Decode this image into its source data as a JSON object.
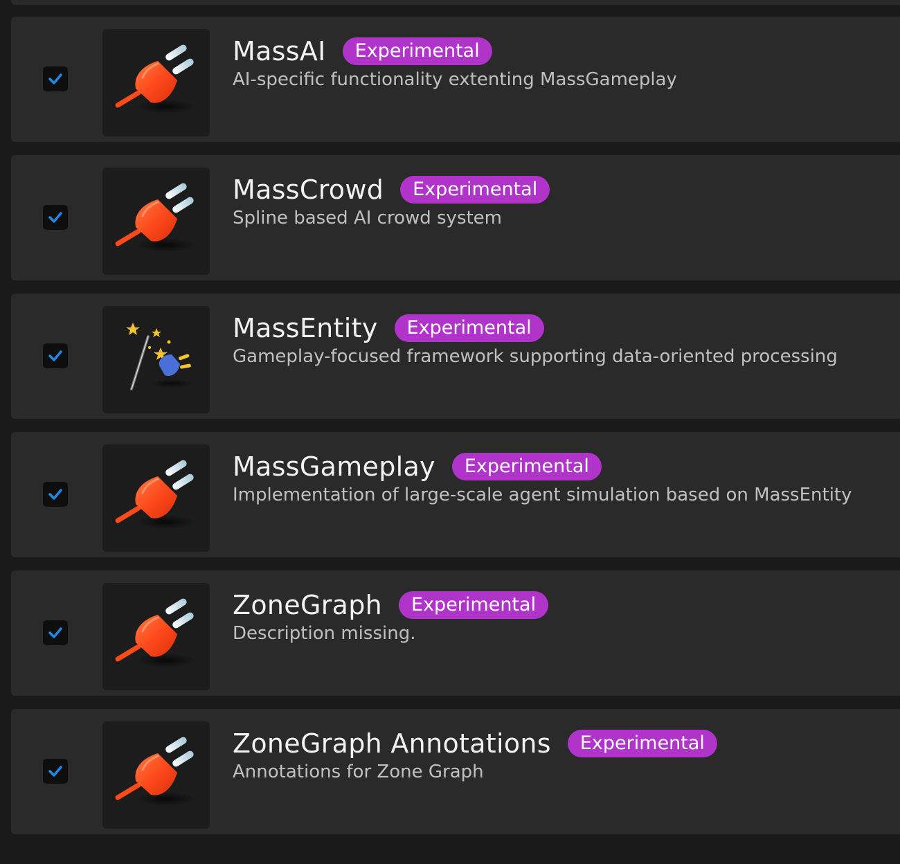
{
  "plugins": [
    {
      "name": "MassAI",
      "badge": "Experimental",
      "description": "AI-specific functionality extenting MassGameplay",
      "enabled": true,
      "icon": "plug-icon"
    },
    {
      "name": "MassCrowd",
      "badge": "Experimental",
      "description": "Spline based AI crowd system",
      "enabled": true,
      "icon": "plug-icon"
    },
    {
      "name": "MassEntity",
      "badge": "Experimental",
      "description": "Gameplay-focused framework supporting data-oriented processing",
      "enabled": true,
      "icon": "magic-wand-plug-icon"
    },
    {
      "name": "MassGameplay",
      "badge": "Experimental",
      "description": "Implementation of large-scale agent simulation based on MassEntity",
      "enabled": true,
      "icon": "plug-icon"
    },
    {
      "name": "ZoneGraph",
      "badge": "Experimental",
      "description": "Description missing.",
      "enabled": true,
      "icon": "plug-icon"
    },
    {
      "name": "ZoneGraph Annotations",
      "badge": "Experimental",
      "description": "Annotations for Zone Graph",
      "enabled": true,
      "icon": "plug-icon"
    }
  ],
  "colors": {
    "badge": "#b034c9",
    "checkmark": "#1e88e5",
    "plug": "#ff4a1c"
  }
}
